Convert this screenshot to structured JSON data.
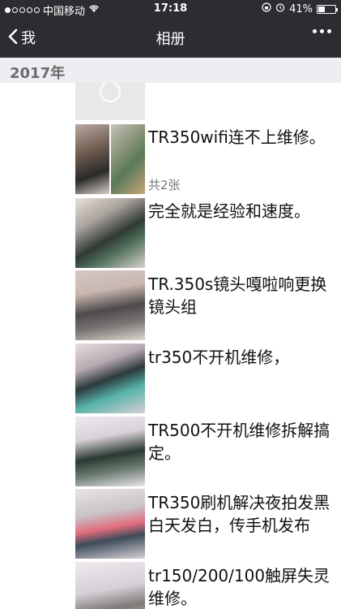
{
  "status_bar": {
    "carrier": "中国移动",
    "time": "17:18",
    "battery": "41%",
    "battery_level": 0.41,
    "icons": [
      "signal-dots",
      "wifi-icon",
      "lock-rotation-icon",
      "alarm-icon",
      "battery-icon"
    ]
  },
  "nav": {
    "back_label": "我",
    "title": "相册",
    "more_icon": "more-dots-icon"
  },
  "section": {
    "year": "2017年"
  },
  "posts": [
    {
      "caption": "TR350wifi连不上维修。",
      "count": "共2张"
    },
    {
      "caption": "完全就是经验和速度。",
      "count": ""
    },
    {
      "caption": "TR.350s镜头嘎啦响更换镜头组",
      "count": ""
    },
    {
      "caption": "tr350不开机维修，",
      "count": ""
    },
    {
      "caption": "TR500不开机维修拆解搞定。",
      "count": ""
    },
    {
      "caption": "TR350刷机解决夜拍发黑白天发白，传手机发布",
      "count": ""
    },
    {
      "caption": "tr150/200/100触屏失灵维修。",
      "count": ""
    }
  ]
}
